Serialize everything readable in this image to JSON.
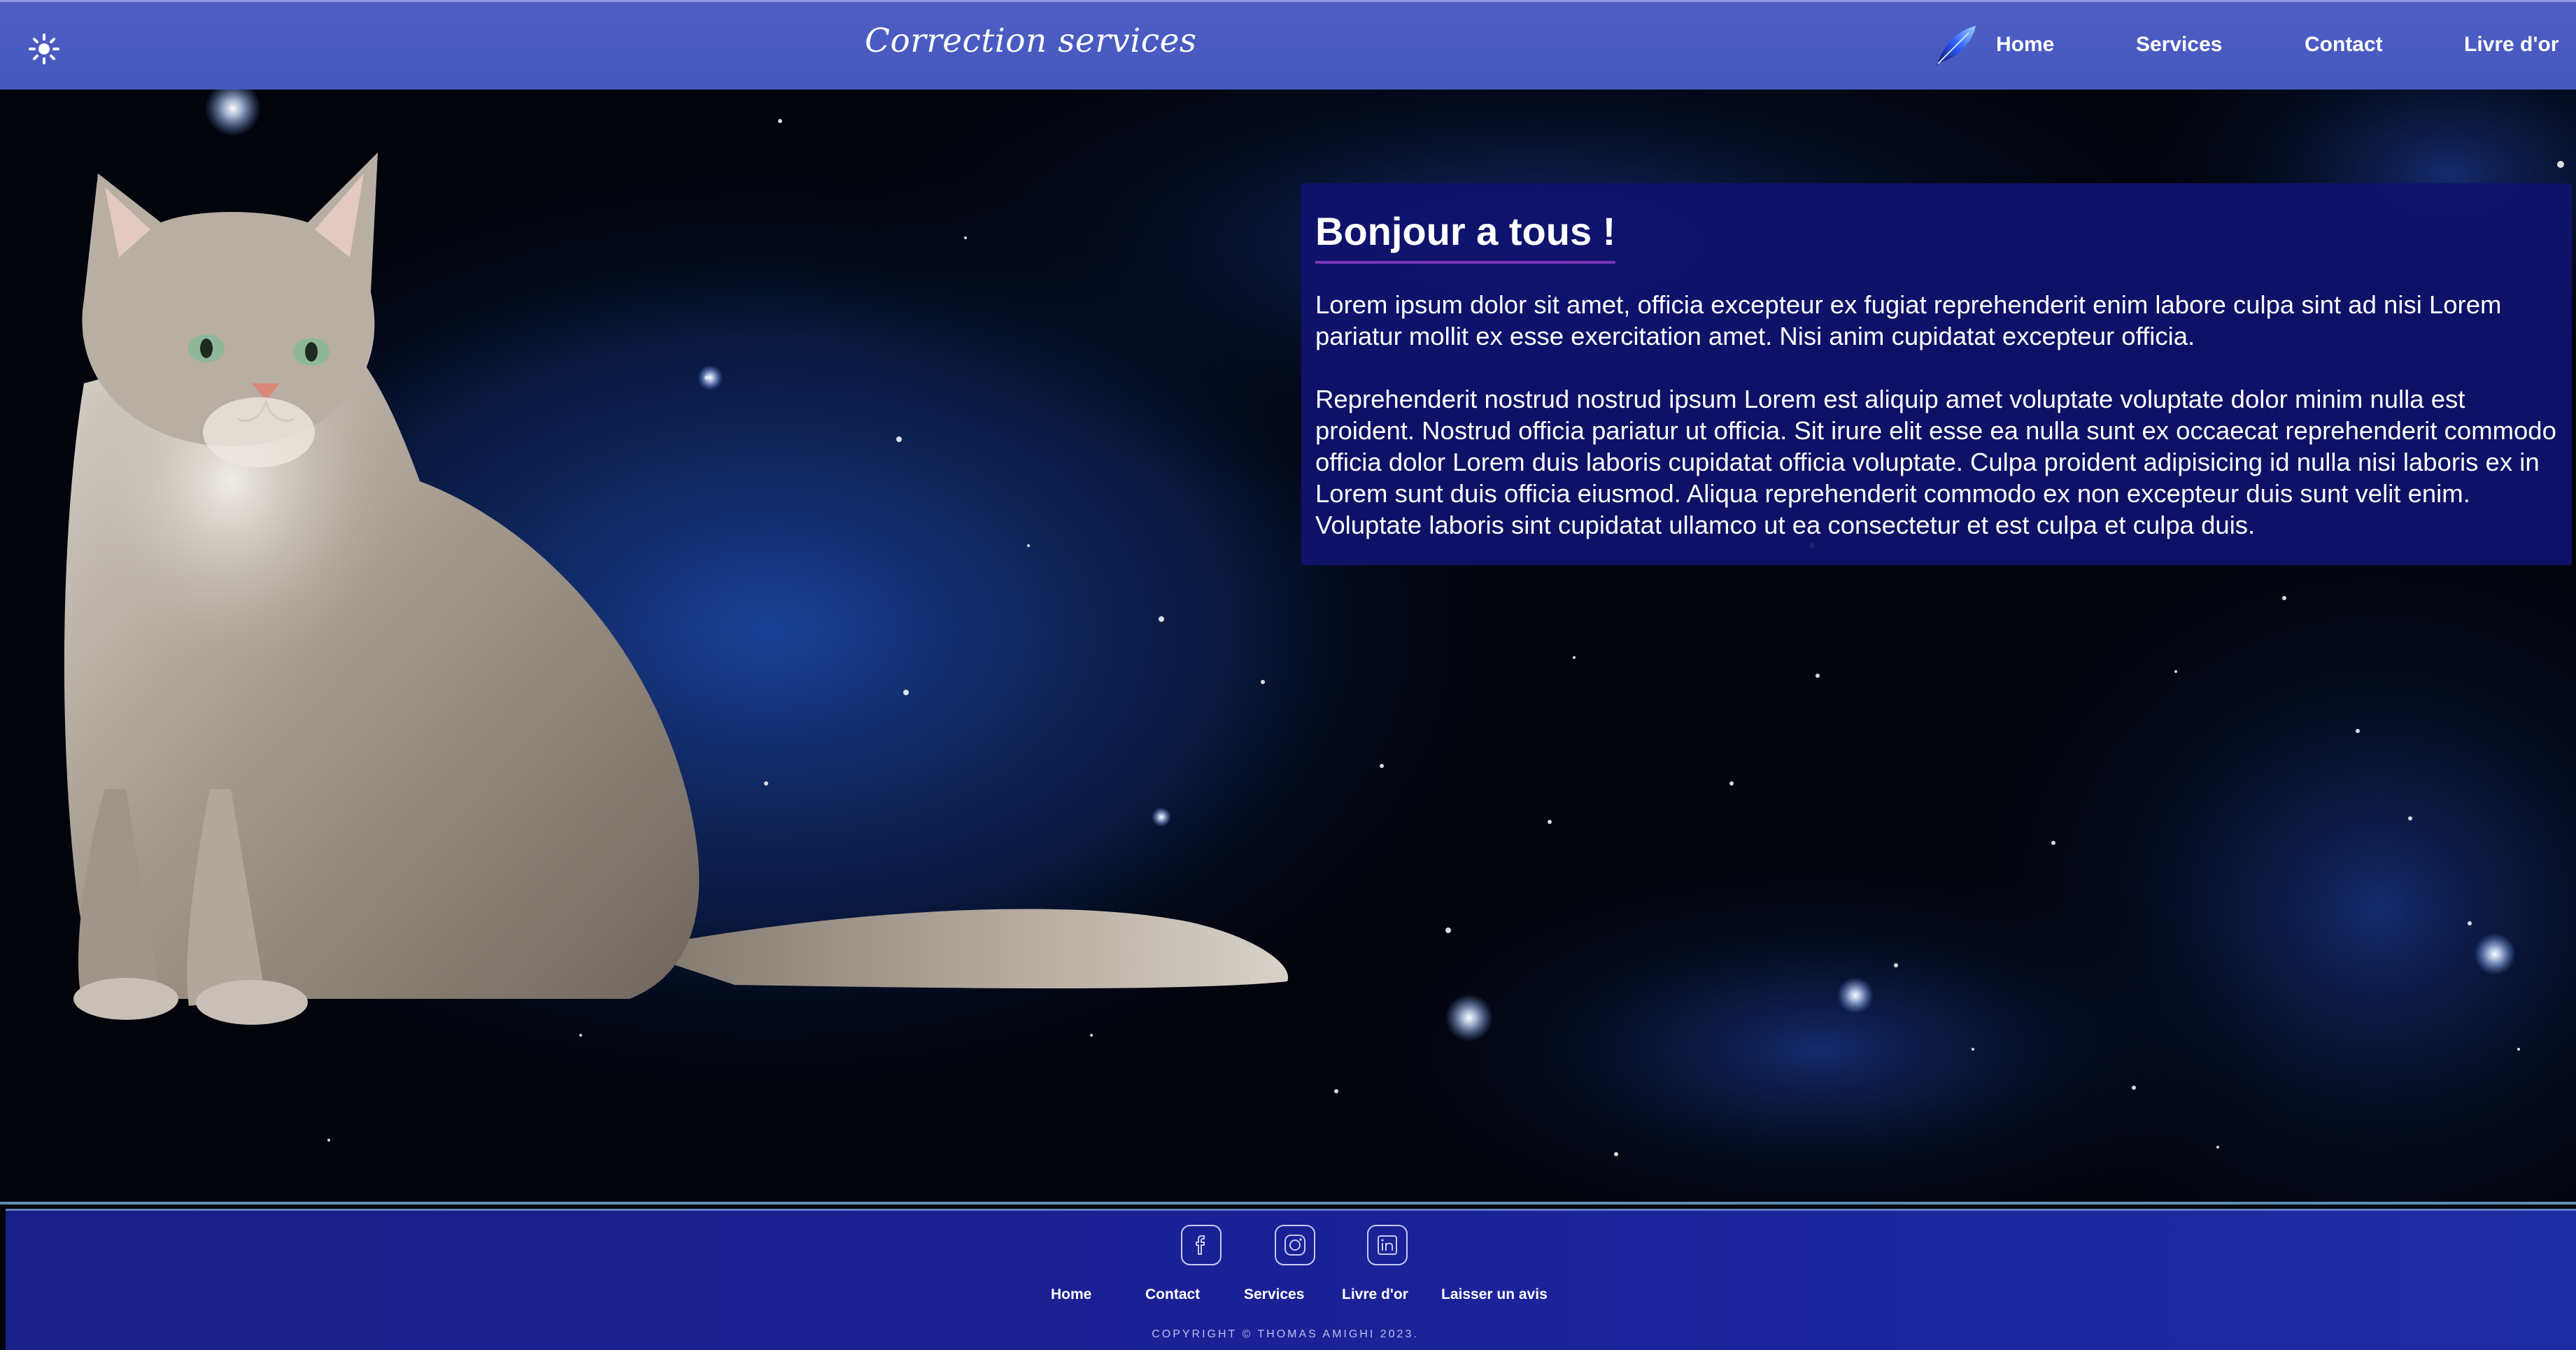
{
  "header": {
    "title": "Correction services",
    "theme_icon": "sun-icon",
    "logo_icon": "feather-logo-icon",
    "nav": [
      {
        "label": "Home"
      },
      {
        "label": "Services"
      },
      {
        "label": "Contact"
      },
      {
        "label": "Livre d'or"
      }
    ]
  },
  "main": {
    "hero_image": "sitting-cat-image",
    "card": {
      "title": "Bonjour a tous !",
      "paragraphs": [
        "Lorem ipsum dolor sit amet, officia excepteur ex fugiat reprehenderit enim labore culpa sint ad nisi Lorem pariatur mollit ex esse exercitation amet. Nisi anim cupidatat excepteur officia.",
        "Reprehenderit nostrud nostrud ipsum Lorem est aliquip amet voluptate voluptate dolor minim nulla est proident. Nostrud officia pariatur ut officia. Sit irure elit esse ea nulla sunt ex occaecat reprehenderit commodo officia dolor Lorem duis laboris cupidatat officia voluptate. Culpa proident adipisicing id nulla nisi laboris ex in Lorem sunt duis officia eiusmod. Aliqua reprehenderit commodo ex non excepteur duis sunt velit enim. Voluptate laboris sint cupidatat ullamco ut ea consectetur et est culpa et culpa duis."
      ]
    }
  },
  "footer": {
    "social": [
      {
        "icon": "facebook-icon"
      },
      {
        "icon": "instagram-icon"
      },
      {
        "icon": "linkedin-icon"
      }
    ],
    "links": [
      {
        "label": "Home"
      },
      {
        "label": "Contact"
      },
      {
        "label": "Services"
      },
      {
        "label": "Livre d'or"
      },
      {
        "label": "Laisser un avis"
      }
    ],
    "copyright": "COPYRIGHT © THOMAS AMIGHI 2023."
  },
  "colors": {
    "header_bg": "#4d5dc4",
    "card_bg": "#10126e",
    "title_underline": "#7a34b8",
    "footer_bg": "#1a2196"
  }
}
